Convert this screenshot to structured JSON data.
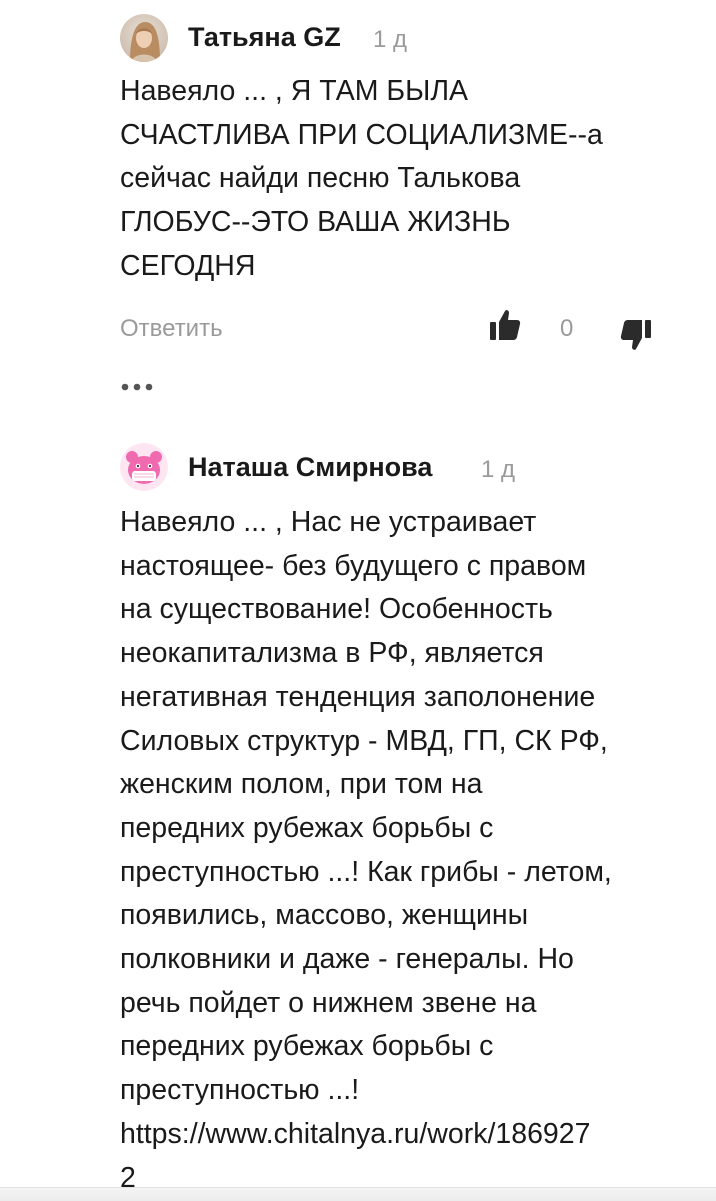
{
  "comments": [
    {
      "author": "Татьяна GZ",
      "time": "1 д",
      "text": "Навеяло ... , Я ТАМ БЫЛА\nСЧАСТЛИВА ПРИ СОЦИАЛИЗМЕ--а\nсейчас найди песню Талькова\nГЛОБУС--ЭТО ВАША ЖИЗНЬ\nСЕГОДНЯ",
      "reply_label": "Ответить",
      "rating": "0"
    },
    {
      "author": "Наташа Смирнова",
      "time": "1 д",
      "text": "Навеяло ... , Нас не устраивает\nнастоящее- без будущего с правом\nна существование! Особенность\nнеокапитализма в РФ, является\nнегативная тенденция заполонение\nСиловых структур - МВД, ГП, СК РФ,\nженским полом, при том на\nпередних рубежах борьбы с\nпреступностью ...! Как грибы - летом,\nпоявились, массово, женщины\nполковники и даже - генералы. Но\nречь пойдет о нижнем звене на\nпередних рубежах борьбы с\nпреступностью ...!\nhttps://www.chitalnya.ru/work/186927\n2"
    }
  ],
  "icons": {
    "like": "thumbs-up-icon",
    "dislike": "thumbs-down-icon",
    "more": "more-dots-icon",
    "avatar_1": "user-photo-avatar",
    "avatar_2": "pink-mascot-avatar"
  },
  "colors": {
    "text": "#1a1a1a",
    "muted": "#9a9a9a",
    "icon_dark": "#2b2b2b",
    "avatar_pink": "#f06ab0"
  }
}
